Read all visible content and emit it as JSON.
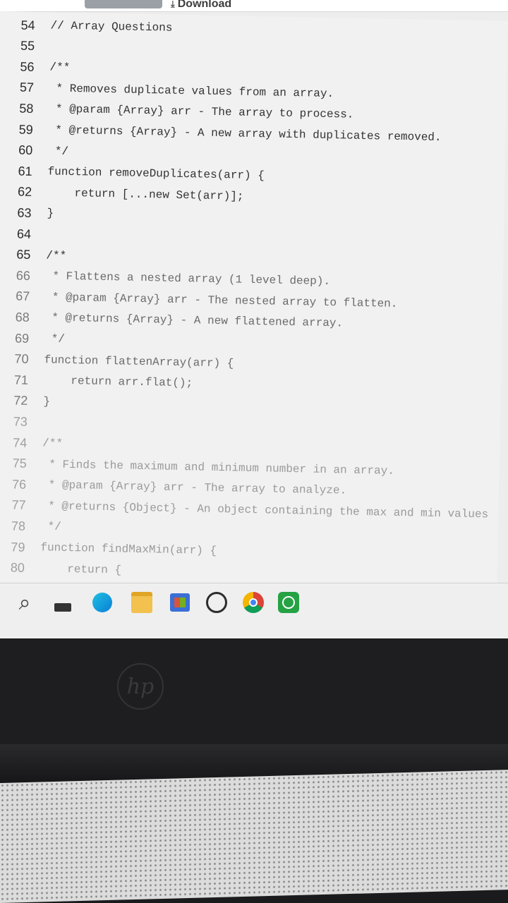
{
  "browser": {
    "download_label": "Download"
  },
  "editor": {
    "lines": [
      {
        "num": "54",
        "text": "// Array Questions"
      },
      {
        "num": "55",
        "text": ""
      },
      {
        "num": "56",
        "text": "/**"
      },
      {
        "num": "57",
        "text": " * Removes duplicate values from an array."
      },
      {
        "num": "58",
        "text": " * @param {Array} arr - The array to process."
      },
      {
        "num": "59",
        "text": " * @returns {Array} - A new array with duplicates removed."
      },
      {
        "num": "60",
        "text": " */"
      },
      {
        "num": "61",
        "text": "function removeDuplicates(arr) {"
      },
      {
        "num": "62",
        "text": "    return [...new Set(arr)];"
      },
      {
        "num": "63",
        "text": "}"
      },
      {
        "num": "64",
        "text": ""
      },
      {
        "num": "65",
        "text": "/**"
      },
      {
        "num": "66",
        "text": " * Flattens a nested array (1 level deep)."
      },
      {
        "num": "67",
        "text": " * @param {Array} arr - The nested array to flatten."
      },
      {
        "num": "68",
        "text": " * @returns {Array} - A new flattened array."
      },
      {
        "num": "69",
        "text": " */"
      },
      {
        "num": "70",
        "text": "function flattenArray(arr) {"
      },
      {
        "num": "71",
        "text": "    return arr.flat();"
      },
      {
        "num": "72",
        "text": "}"
      },
      {
        "num": "73",
        "text": ""
      },
      {
        "num": "74",
        "text": "/**"
      },
      {
        "num": "75",
        "text": " * Finds the maximum and minimum number in an array."
      },
      {
        "num": "76",
        "text": " * @param {Array} arr - The array to analyze."
      },
      {
        "num": "77",
        "text": " * @returns {Object} - An object containing the max and min values"
      },
      {
        "num": "78",
        "text": " */"
      },
      {
        "num": "79",
        "text": "function findMaxMin(arr) {"
      },
      {
        "num": "80",
        "text": "    return {"
      }
    ]
  },
  "taskbar": {
    "icons": [
      "search-icon",
      "widgets-icon",
      "edge-icon",
      "file-explorer-icon",
      "store-icon",
      "whatsapp-icon",
      "chrome-icon",
      "whatsapp-business-icon"
    ]
  },
  "device": {
    "logo_text": "hp"
  }
}
